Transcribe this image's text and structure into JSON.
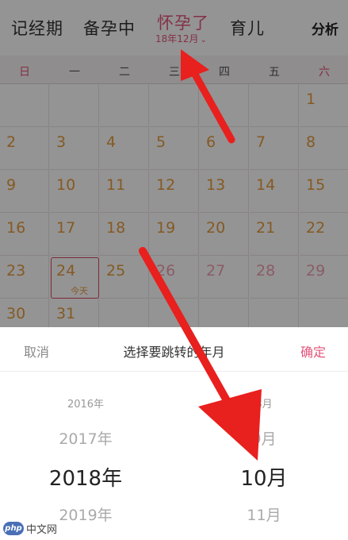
{
  "tabs": {
    "record": "记经期",
    "prep": "备孕中",
    "pregnant": "怀孕了",
    "pregnant_month": "18年12月",
    "baby": "育儿",
    "analysis": "分析"
  },
  "weekdays": [
    "日",
    "一",
    "二",
    "三",
    "四",
    "五",
    "六"
  ],
  "calendar_rows": [
    [
      "",
      "",
      "",
      "",
      "",
      "",
      "1"
    ],
    [
      "2",
      "3",
      "4",
      "5",
      "6",
      "7",
      "8"
    ],
    [
      "9",
      "10",
      "11",
      "12",
      "13",
      "14",
      "15"
    ],
    [
      "16",
      "17",
      "18",
      "19",
      "20",
      "21",
      "22"
    ],
    [
      "23",
      "24",
      "25",
      "26",
      "27",
      "28",
      "29"
    ],
    [
      "30",
      "31",
      "",
      "",
      "",
      "",
      ""
    ]
  ],
  "today": {
    "day": "24",
    "label": "今天"
  },
  "picker": {
    "cancel": "取消",
    "title": "选择要跳转的年月",
    "confirm": "确定",
    "years": [
      "2016年",
      "2017年",
      "2018年",
      "2019年",
      ""
    ],
    "months": [
      "8月",
      "9月",
      "10月",
      "11月",
      ""
    ],
    "selected_year": "2018年",
    "selected_month": "10月"
  },
  "colors": {
    "accent": "#e2557a",
    "day_number": "#e59b3f",
    "arrow": "#e8201e"
  },
  "watermark": {
    "logo": "php",
    "text": "中文网"
  }
}
